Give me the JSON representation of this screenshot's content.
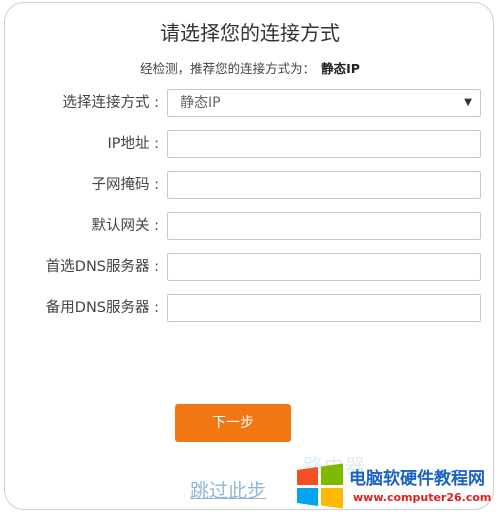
{
  "title": "请选择您的连接方式",
  "subtitle": {
    "prefix": "经检测，推荐您的连接方式为：",
    "recommended": "静态IP"
  },
  "form": {
    "connection_type": {
      "label": "选择连接方式 :",
      "selected": "静态IP"
    },
    "ip_address": {
      "label": "IP地址 :",
      "value": ""
    },
    "subnet_mask": {
      "label": "子网掩码 :",
      "value": ""
    },
    "default_gateway": {
      "label": "默认网关 :",
      "value": ""
    },
    "primary_dns": {
      "label": "首选DNS服务器 :",
      "value": ""
    },
    "secondary_dns": {
      "label": "备用DNS服务器 :",
      "value": ""
    }
  },
  "actions": {
    "next_label": "下一步",
    "skip_label": "跳过此步"
  },
  "watermark": {
    "title": "电脑软硬件教程网",
    "url": "www.computer26.com",
    "ghost": "路由器"
  },
  "icons": {
    "dropdown_arrow": "caret-down-icon",
    "watermark_logo": "windows-logo-icon"
  },
  "colors": {
    "accent": "#f07712",
    "link": "#8fb6d8",
    "watermark_blue": "#1a62c4",
    "watermark_red": "#e02020"
  }
}
